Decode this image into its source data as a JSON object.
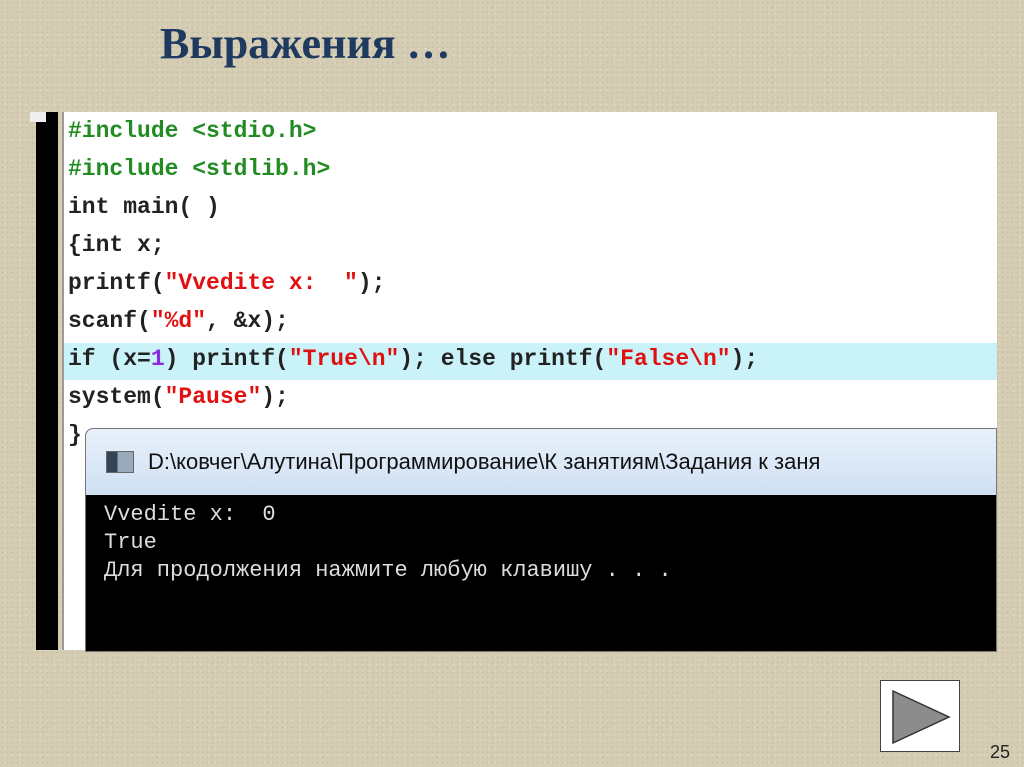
{
  "slide": {
    "title": "Выражения …",
    "page_number": "25"
  },
  "code": {
    "lines": [
      [
        {
          "t": "#include <stdio.h>",
          "c": "pp"
        }
      ],
      [
        {
          "t": "#include <stdlib.h>",
          "c": "pp"
        }
      ],
      [
        {
          "t": "int main( )",
          "c": ""
        }
      ],
      [
        {
          "t": "{int x;",
          "c": ""
        }
      ],
      [
        {
          "t": "printf(",
          "c": ""
        },
        {
          "t": "\"Vvedite x:  \"",
          "c": "str"
        },
        {
          "t": ");",
          "c": ""
        }
      ],
      [
        {
          "t": "scanf(",
          "c": ""
        },
        {
          "t": "\"%d\"",
          "c": "str"
        },
        {
          "t": ", &x);",
          "c": ""
        }
      ],
      [
        {
          "t": "if (x=",
          "c": ""
        },
        {
          "t": "1",
          "c": "num"
        },
        {
          "t": ") printf(",
          "c": ""
        },
        {
          "t": "\"True\\n\"",
          "c": "str"
        },
        {
          "t": "); else printf(",
          "c": ""
        },
        {
          "t": "\"False\\n\"",
          "c": "str"
        },
        {
          "t": ");",
          "c": ""
        }
      ],
      [
        {
          "t": "system(",
          "c": ""
        },
        {
          "t": "\"Pause\"",
          "c": "str"
        },
        {
          "t": ");",
          "c": ""
        }
      ],
      [
        {
          "t": "}",
          "c": ""
        }
      ]
    ],
    "highlighted_line": 6
  },
  "console": {
    "title": "D:\\ковчег\\Алутина\\Программирование\\К занятиям\\Задания к заня",
    "output": [
      "Vvedite x:  0",
      "True",
      "Для продолжения нажмите любую клавишу . . ."
    ]
  },
  "colors": {
    "highlight": "#c9f3f8",
    "preprocessor": "#228b22",
    "string": "#e01010"
  }
}
